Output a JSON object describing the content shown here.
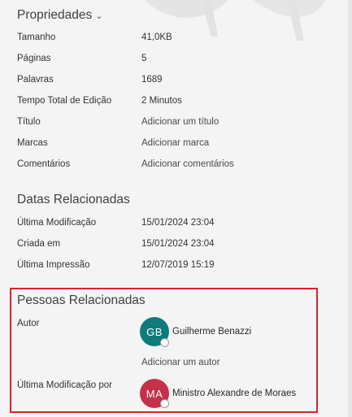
{
  "properties": {
    "title": "Propriedades",
    "chevron_icon": "chevron-down-icon",
    "rows": [
      {
        "label": "Tamanho",
        "value": "41,0KB"
      },
      {
        "label": "Páginas",
        "value": "5"
      },
      {
        "label": "Palavras",
        "value": "1689"
      },
      {
        "label": "Tempo Total de Edição",
        "value": "2 Minutos"
      },
      {
        "label": "Título",
        "value": "Adicionar um título"
      },
      {
        "label": "Marcas",
        "value": "Adicionar marca"
      },
      {
        "label": "Comentários",
        "value": "Adicionar comentários"
      }
    ]
  },
  "dates": {
    "title": "Datas Relacionadas",
    "rows": [
      {
        "label": "Última Modificação",
        "value": "15/01/2024 23:04"
      },
      {
        "label": "Criada em",
        "value": "15/01/2024 23:04"
      },
      {
        "label": "Última Impressão",
        "value": "12/07/2019 15:19"
      }
    ]
  },
  "people": {
    "title": "Pessoas Relacionadas",
    "author_label": "Autor",
    "author": {
      "initials": "GB",
      "name": "Guilherme Benazzi",
      "color": "#0f7b7b"
    },
    "add_author": "Adicionar um autor",
    "last_modified_label": "Última Modificação por",
    "last_modified_by": {
      "initials": "MA",
      "name": "Ministro Alexandre de Moraes",
      "color": "#c4314b"
    },
    "highlight_color": "#e0202a"
  }
}
